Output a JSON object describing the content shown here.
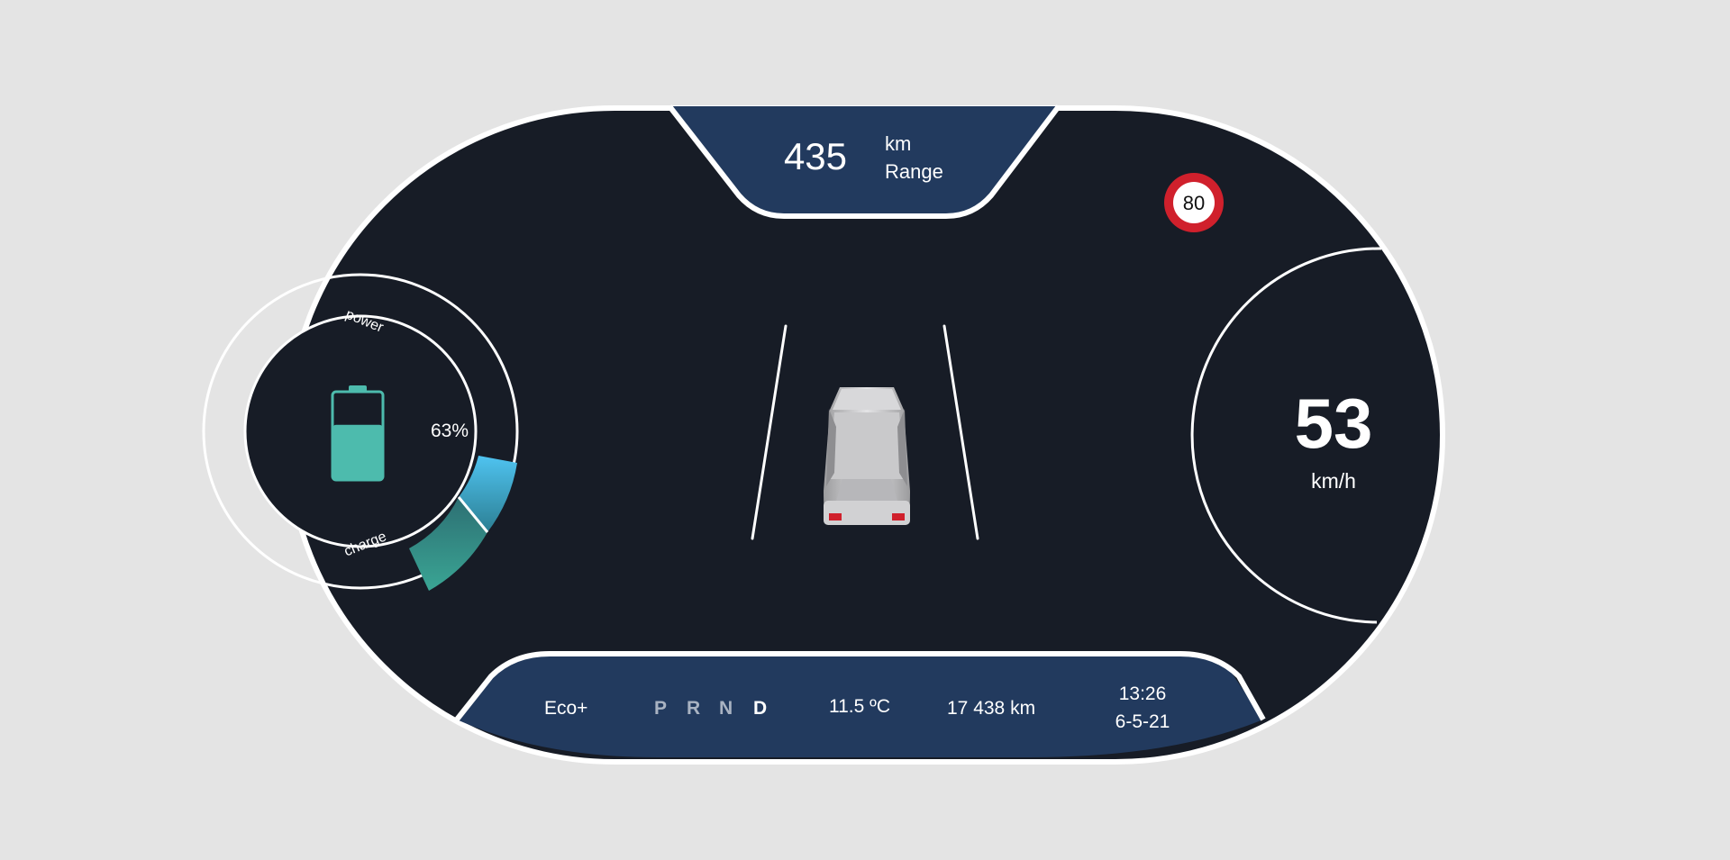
{
  "range": {
    "value": "435",
    "unit": "km",
    "label": "Range"
  },
  "speed_limit": {
    "value": "80"
  },
  "speed": {
    "value": "53",
    "unit": "km/h"
  },
  "battery": {
    "percent_text": "63%",
    "level": 0.63,
    "power_label": "power",
    "charge_label": "charge"
  },
  "status_bar": {
    "drive_mode": "Eco+",
    "gears": [
      {
        "label": "P",
        "active": false
      },
      {
        "label": "R",
        "active": false
      },
      {
        "label": "N",
        "active": false
      },
      {
        "label": "D",
        "active": true
      }
    ],
    "temperature": "11.5 ºC",
    "odometer": "17 438 km",
    "time": "13:26",
    "date": "6-5-21"
  },
  "colors": {
    "page_background": "#e4e4e4",
    "panel": "#171c26",
    "accent_blue": "#223a5e",
    "outline": "#ffffff",
    "battery": "#4dbbad",
    "power_gauge": "#4fc3f0",
    "charge_gauge": "#3aa594",
    "speed_limit_ring": "#d0202c",
    "inactive_gear": "#a9b3c2"
  },
  "icons": {
    "battery": "battery-icon",
    "speed_limit": "speed-limit-sign-icon",
    "car": "car-rear-view-icon",
    "lanes": "lane-lines-icon"
  }
}
